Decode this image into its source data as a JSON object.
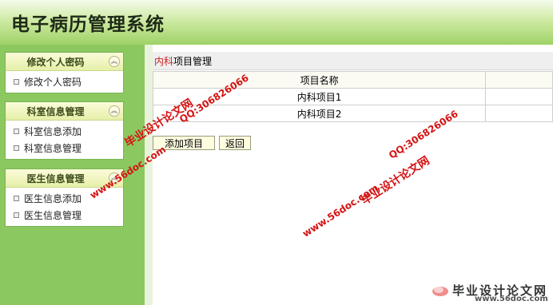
{
  "app": {
    "title": "电子病历管理系统"
  },
  "sidebar": {
    "groups": [
      {
        "title": "修改个人密码",
        "items": [
          "修改个人密码"
        ]
      },
      {
        "title": "科室信息管理",
        "items": [
          "科室信息添加",
          "科室信息管理"
        ]
      },
      {
        "title": "医生信息管理",
        "items": [
          "医生信息添加",
          "医生信息管理"
        ]
      }
    ]
  },
  "main": {
    "department": "内科",
    "page_title_suffix": "项目管理",
    "table": {
      "headers": [
        "项目名称",
        ""
      ],
      "rows": [
        [
          "内科项目1",
          ""
        ],
        [
          "内科项目2",
          ""
        ]
      ]
    },
    "buttons": {
      "add": "添加项目",
      "back": "返回"
    }
  },
  "watermarks": {
    "wm1": "毕业设计论文网",
    "wm2": "QQ:306826066",
    "wm3": "www.56doc.com",
    "logo_text": "毕业设计论文网",
    "logo_url": "www.56doc.com"
  },
  "colors": {
    "header": "#b5dc86",
    "sidebar": "#8cc860",
    "watermark": "#d41414",
    "dept": "#cc2222"
  },
  "icons": {
    "collapse": "double-chevron-up-icon",
    "bullet": "square-bullet-icon"
  }
}
